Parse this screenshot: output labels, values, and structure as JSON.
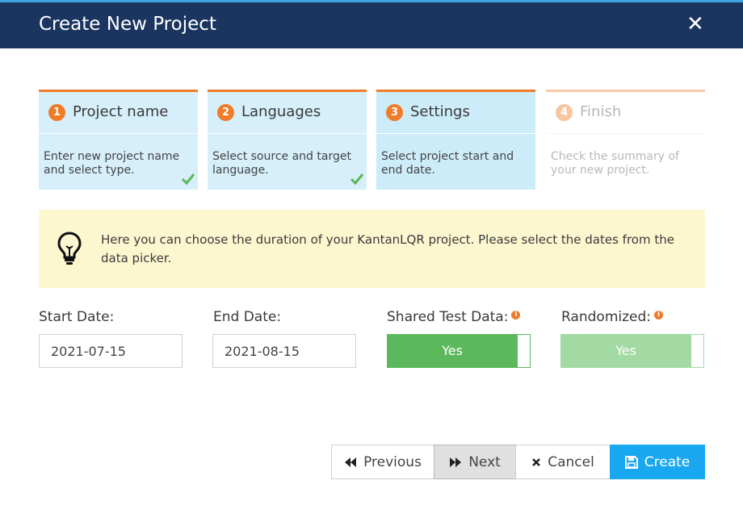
{
  "dialog": {
    "title": "Create New Project",
    "close_icon": "close-icon"
  },
  "steps": [
    {
      "number": "1",
      "title": "Project name",
      "desc": "Enter new project name and select type.",
      "state": "completed"
    },
    {
      "number": "2",
      "title": "Languages",
      "desc": "Select source and target language.",
      "state": "completed"
    },
    {
      "number": "3",
      "title": "Settings",
      "desc": "Select project start and end date.",
      "state": "current"
    },
    {
      "number": "4",
      "title": "Finish",
      "desc": "Check the summary of your new project.",
      "state": "pending"
    }
  ],
  "info": {
    "icon": "lightbulb-icon",
    "text": "Here you can choose the duration of your KantanLQR project. Please select the dates from the data picker."
  },
  "fields": {
    "start_date": {
      "label": "Start Date:",
      "value": "2021-07-15"
    },
    "end_date": {
      "label": "End Date:",
      "value": "2021-08-15"
    },
    "shared_test_data": {
      "label": "Shared Test Data:",
      "value": "Yes",
      "info_icon": "info-icon"
    },
    "randomized": {
      "label": "Randomized:",
      "value": "Yes",
      "info_icon": "info-icon"
    }
  },
  "buttons": {
    "previous": "Previous",
    "next": "Next",
    "cancel": "Cancel",
    "create": "Create"
  },
  "colors": {
    "header": "#1b3560",
    "accent_orange": "#f07c2a",
    "step_bg": "#d6effa",
    "toggle_on": "#5cb85c",
    "primary_button": "#19a8ef",
    "info_bg": "#fdf7d0"
  }
}
